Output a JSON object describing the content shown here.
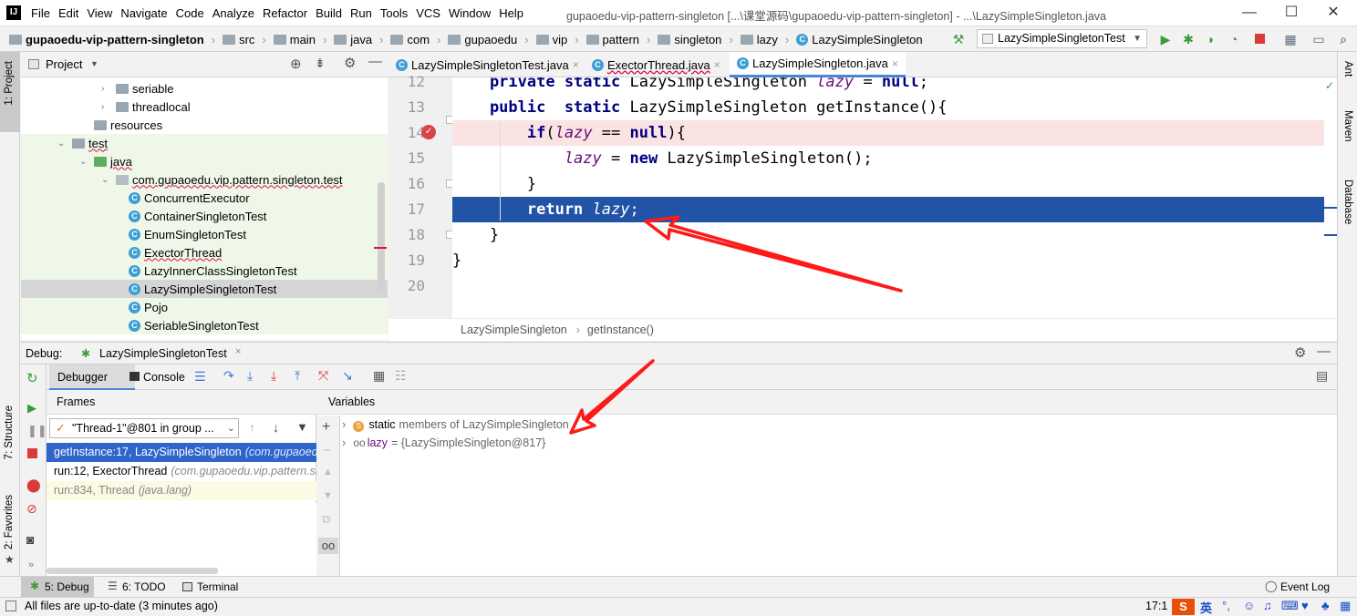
{
  "menubar": {
    "items": [
      "File",
      "Edit",
      "View",
      "Navigate",
      "Code",
      "Analyze",
      "Refactor",
      "Build",
      "Run",
      "Tools",
      "VCS",
      "Window",
      "Help"
    ],
    "window_title": "gupaoedu-vip-pattern-singleton [...\\课堂源码\\gupaoedu-vip-pattern-singleton] - ...\\LazySimpleSingleton.java"
  },
  "navbar": {
    "breadcrumbs": [
      "gupaoedu-vip-pattern-singleton",
      "src",
      "main",
      "java",
      "com",
      "gupaoedu",
      "vip",
      "pattern",
      "singleton",
      "lazy",
      "LazySimpleSingleton"
    ],
    "run_config": "LazySimpleSingletonTest"
  },
  "left_stripe": {
    "project": "1: Project",
    "structure": "7: Structure",
    "favorites": "2: Favorites"
  },
  "right_stripe": {
    "ant": "Ant",
    "maven": "Maven",
    "database": "Database"
  },
  "project": {
    "title": "Project",
    "tree": [
      {
        "label": "seriable",
        "type": "folder",
        "indent": 1
      },
      {
        "label": "threadlocal",
        "type": "folder",
        "indent": 1
      },
      {
        "label": "resources",
        "type": "folder",
        "indent": 0
      },
      {
        "label": "test",
        "type": "folder",
        "indent": -1
      },
      {
        "label": "java",
        "type": "srcfolder",
        "indent": 0
      },
      {
        "label": "com.gupaoedu.vip.pattern.singleton.test",
        "type": "package",
        "indent": 1
      },
      {
        "label": "ConcurrentExecutor",
        "type": "class",
        "indent": 2
      },
      {
        "label": "ContainerSingletonTest",
        "type": "class",
        "indent": 2
      },
      {
        "label": "EnumSingletonTest",
        "type": "class",
        "indent": 2
      },
      {
        "label": "ExectorThread",
        "type": "class",
        "indent": 2
      },
      {
        "label": "LazyInnerClassSingletonTest",
        "type": "class",
        "indent": 2
      },
      {
        "label": "LazySimpleSingletonTest",
        "type": "class",
        "indent": 2
      },
      {
        "label": "Pojo",
        "type": "class",
        "indent": 2
      },
      {
        "label": "SeriableSingletonTest",
        "type": "class",
        "indent": 2
      }
    ]
  },
  "editor": {
    "tabs": [
      "LazySimpleSingletonTest.java",
      "ExectorThread.java",
      "LazySimpleSingleton.java"
    ],
    "lines": [
      {
        "n": "12",
        "parts": [
          [
            "kw",
            "    private static "
          ],
          [
            "t",
            "LazySimpleSingleton "
          ],
          [
            "fld",
            "lazy"
          ],
          [
            "t",
            " = "
          ],
          [
            "kw",
            "null"
          ],
          [
            "t",
            ";"
          ]
        ]
      },
      {
        "n": "13",
        "parts": [
          [
            "kw",
            "    public  static "
          ],
          [
            "t",
            "LazySimpleSingleton getInstance(){"
          ]
        ]
      },
      {
        "n": "14",
        "parts": [
          [
            "kw",
            "        if"
          ],
          [
            "t",
            "("
          ],
          [
            "fld",
            "lazy"
          ],
          [
            "t",
            " == "
          ],
          [
            "kw",
            "null"
          ],
          [
            "t",
            "){"
          ]
        ]
      },
      {
        "n": "15",
        "parts": [
          [
            "fld",
            "            lazy"
          ],
          [
            "t",
            " = "
          ],
          [
            "kw",
            "new "
          ],
          [
            "t",
            "LazySimpleSingleton();"
          ]
        ]
      },
      {
        "n": "16",
        "parts": [
          [
            "t",
            "        }"
          ]
        ]
      },
      {
        "n": "17",
        "parts": [
          [
            "kw",
            "        return "
          ],
          [
            "fld",
            "lazy"
          ],
          [
            "t",
            ";"
          ]
        ]
      },
      {
        "n": "18",
        "parts": [
          [
            "t",
            "    }"
          ]
        ]
      },
      {
        "n": "19",
        "parts": [
          [
            "t",
            "}"
          ]
        ]
      },
      {
        "n": "20",
        "parts": []
      }
    ],
    "breadcrumb": [
      "LazySimpleSingleton",
      "getInstance()"
    ]
  },
  "debug": {
    "label": "Debug:",
    "session_tab": "LazySimpleSingletonTest",
    "tabs": [
      "Debugger",
      "Console"
    ],
    "frames_title": "Frames",
    "thread": "\"Thread-1\"@801 in group ...",
    "frames": [
      {
        "method": "getInstance:17, LazySimpleSingleton",
        "pkg": "(com.gupaoedu.vip.pattern.singleton.lazy)"
      },
      {
        "method": "run:12, ExectorThread",
        "pkg": "(com.gupaoedu.vip.pattern.singleton.test)"
      },
      {
        "method": "run:834, Thread",
        "pkg": "(java.lang)"
      }
    ],
    "variables_title": "Variables",
    "variables": [
      {
        "prefix": "static",
        "text": "members of LazySimpleSingleton"
      },
      {
        "prefix": "lazy",
        "text": "= {LazySimpleSingleton@817}"
      }
    ]
  },
  "bottom_tabs": {
    "debug": "5: Debug",
    "todo": "6: TODO",
    "terminal": "Terminal",
    "event_log": "Event Log"
  },
  "status": {
    "message": "All files are up-to-date (3 minutes ago)",
    "position": "17:1",
    "ime": "英"
  },
  "colors": {
    "exec_line": "#2154a6",
    "breakpoint_line": "#fae3e3",
    "arrow": "#ff1a1a",
    "keyword": "#000080",
    "field": "#660e7a"
  }
}
